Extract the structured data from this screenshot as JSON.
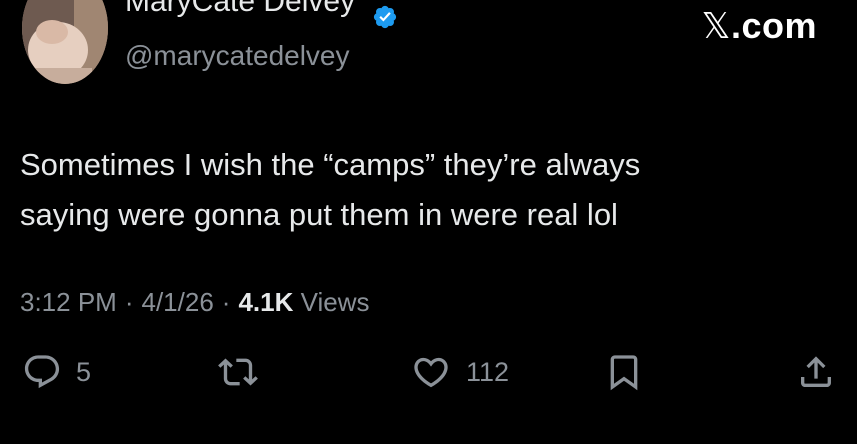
{
  "author": {
    "display_name": "MaryCate Delvey",
    "handle": "@marycatedelvey",
    "verified_color": "#1d9bf0",
    "avatar_icon": "profile-photo"
  },
  "watermark": {
    "glyph": "𝕏",
    "suffix": ".com"
  },
  "tweet": {
    "lines": [
      "Sometimes I wish the “camps” they’re always",
      "saying were gonna put them in were real lol"
    ]
  },
  "meta": {
    "time": "3:12 PM",
    "date": "4/1/26",
    "views_count": "4.1K",
    "views_label": "Views",
    "separator": "·"
  },
  "actions": {
    "reply": {
      "icon": "reply-icon",
      "count": "5"
    },
    "retweet": {
      "icon": "retweet-icon",
      "count": ""
    },
    "like": {
      "icon": "heart-icon",
      "count": "112"
    },
    "bookmark": {
      "icon": "bookmark-icon"
    },
    "share": {
      "icon": "share-icon"
    }
  }
}
